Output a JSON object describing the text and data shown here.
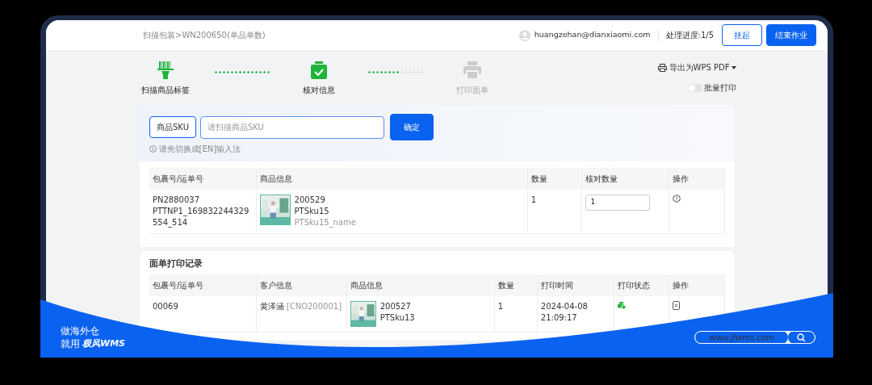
{
  "breadcrumb": "扫描包装>WN200650(单品单数)",
  "user": {
    "email": "huangzehan@dianxiaomi.com"
  },
  "progress": "处理进度:1/5",
  "buttons": [
    {
      "label": "挂起",
      "kind": "outline"
    },
    {
      "label": "结束作业",
      "kind": "primary"
    }
  ],
  "steps": [
    {
      "label": "扫描商品标签",
      "kind": "scan",
      "done": true
    },
    {
      "label": "核对信息",
      "kind": "check",
      "done": true
    },
    {
      "label": "打印面单",
      "kind": "print",
      "done": false
    }
  ],
  "connectors": [
    {
      "level": 1
    },
    {
      "level": 0.55
    }
  ],
  "export": {
    "label": "导出为WPS PDF"
  },
  "batch_print": {
    "label": "批量打印",
    "on": false
  },
  "sku_field": {
    "label": "商品SKU",
    "placeholder": "请扫描商品SKU"
  },
  "confirm_button": "确定",
  "hint": "请先切换成[EN]输入法",
  "check_table": {
    "columns": [
      "包裹号/运单号",
      "商品信息",
      "数量",
      "核对数量",
      "操作"
    ],
    "rows": [
      {
        "package": [
          "PN2880037",
          "PTTNP1_169832244329554_514"
        ],
        "product": {
          "code": "200529",
          "sku": "PTSku15",
          "name": "PTSku15_name"
        },
        "quantity": "1",
        "checked_quantity": "1"
      }
    ]
  },
  "print_records": {
    "title": "面单打印记录",
    "columns": [
      "包裹号/运单号",
      "客户信息",
      "商品信息",
      "数量",
      "打印时间",
      "打印状态",
      "操作"
    ],
    "rows": [
      {
        "package": "00069",
        "customer": "黄泽涵",
        "customer_code": "[CNO200001]",
        "product": {
          "code": "200527",
          "sku": "PTSku13"
        },
        "quantity": "1",
        "print_time": [
          "2024-04-08",
          "21:09:17"
        ],
        "printed": true
      }
    ]
  },
  "promo": {
    "lines": [
      "做海外仓",
      "就用"
    ],
    "logo": "极风WMS",
    "search_value": "www.jfwms.com"
  }
}
